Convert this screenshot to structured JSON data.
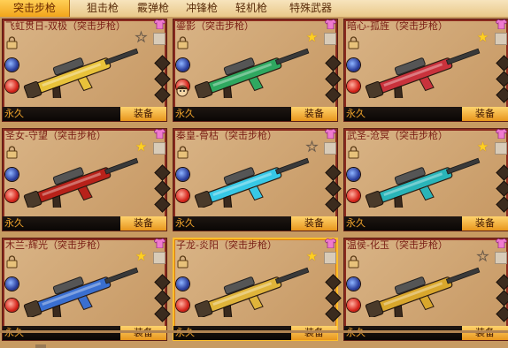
{
  "tabs": [
    {
      "label": "突击步枪",
      "active": true
    },
    {
      "label": "狙击枪",
      "active": false
    },
    {
      "label": "霰弹枪",
      "active": false
    },
    {
      "label": "冲锋枪",
      "active": false
    },
    {
      "label": "轻机枪",
      "active": false
    },
    {
      "label": "特殊武器",
      "active": false
    }
  ],
  "weapons": [
    {
      "name": "飞虹贯日-双极（突击步枪）",
      "favorite": false,
      "duration": "永久",
      "equip_label": "装备",
      "gun_color": "#e8c23a"
    },
    {
      "name": "鎏影（突击步枪）",
      "favorite": true,
      "duration": "永久",
      "equip_label": "装备",
      "gun_color": "#2fa860"
    },
    {
      "name": "暗心-孤旌（突击步枪）",
      "favorite": true,
      "duration": "永久",
      "equip_label": "装备",
      "gun_color": "#c9323c"
    },
    {
      "name": "圣女-守望（突击步枪）",
      "favorite": true,
      "duration": "永久",
      "equip_label": "装备",
      "gun_color": "#b8221a"
    },
    {
      "name": "秦皇-骨枯（突击步枪）",
      "favorite": false,
      "duration": "永久",
      "equip_label": "装备",
      "gun_color": "#37c8e6"
    },
    {
      "name": "武圣-沧冥（突击步枪）",
      "favorite": true,
      "duration": "永久",
      "equip_label": "装备",
      "gun_color": "#2ab4b8"
    },
    {
      "name": "木兰-辉光（突击步枪）",
      "favorite": true,
      "duration": "永久",
      "equip_label": "装备",
      "gun_color": "#3a6fd0"
    },
    {
      "name": "子龙-炎阳（突击步枪）",
      "favorite": true,
      "duration": "永久",
      "equip_label": "装备",
      "gun_color": "#e0b43a"
    },
    {
      "name": "温侯-化玉（突击步枪）",
      "favorite": false,
      "duration": "永久",
      "equip_label": "装备",
      "gun_color": "#d9a72c"
    }
  ]
}
